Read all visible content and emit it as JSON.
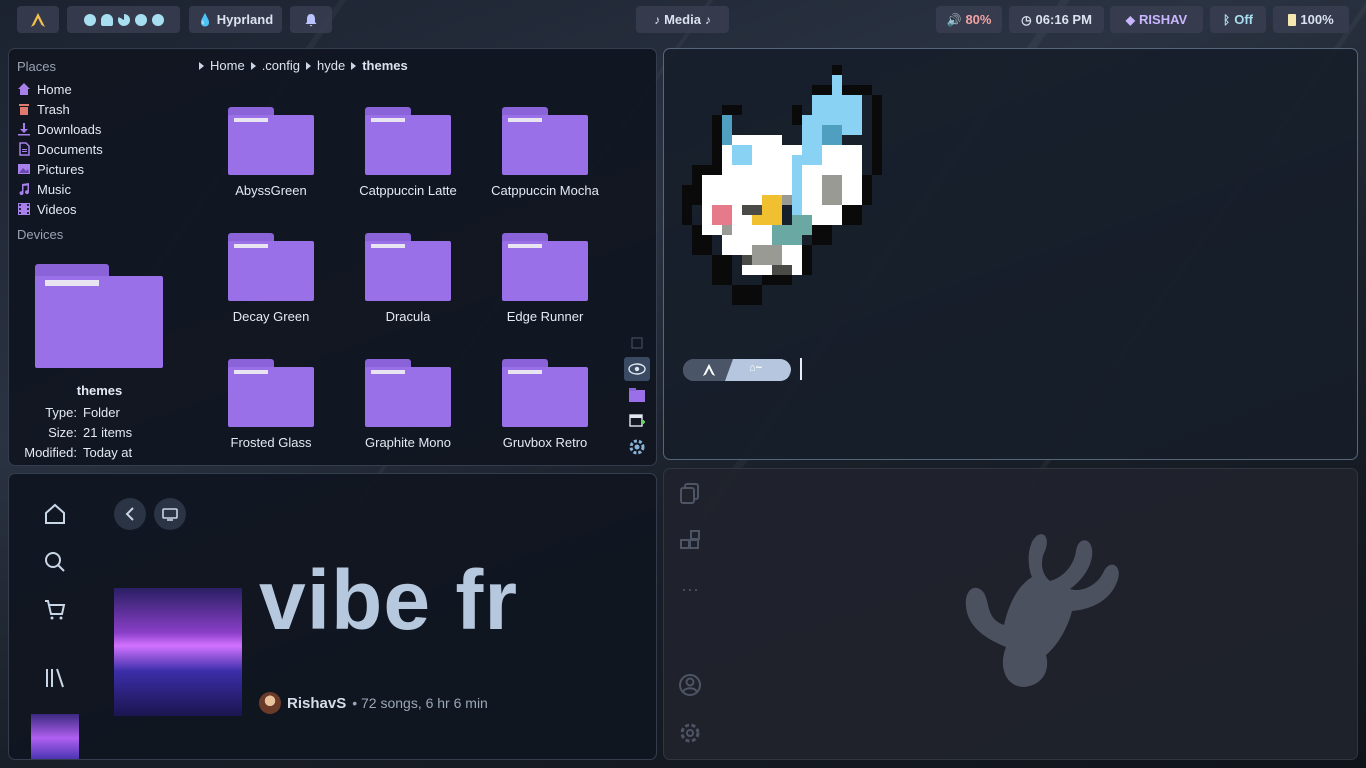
{
  "topbar": {
    "launcher_icon": "arch-logo-icon",
    "workspace_icons": [
      "dot",
      "ghost",
      "pacman",
      "dot",
      "dot"
    ],
    "wm_label": "Hyprland",
    "notification_icon": "bell-icon",
    "media_label": "Media",
    "volume": "80%",
    "clock": "06:16 PM",
    "user": "RISHAV",
    "bluetooth": "Off",
    "battery": "100%"
  },
  "files": {
    "places_heading": "Places",
    "places": [
      {
        "label": "Home",
        "icon": "home-icon"
      },
      {
        "label": "Trash",
        "icon": "trash-icon"
      },
      {
        "label": "Downloads",
        "icon": "download-icon"
      },
      {
        "label": "Documents",
        "icon": "document-icon"
      },
      {
        "label": "Pictures",
        "icon": "picture-icon"
      },
      {
        "label": "Music",
        "icon": "music-icon"
      },
      {
        "label": "Videos",
        "icon": "video-icon"
      }
    ],
    "devices_heading": "Devices",
    "selected": {
      "name": "themes",
      "type_label": "Type:",
      "type_value": "Folder",
      "size_label": "Size:",
      "size_value": "21 items",
      "modified_label": "Modified:",
      "modified_value": "Today at"
    },
    "breadcrumb": [
      "Home",
      ".config",
      "hyde",
      "themes"
    ],
    "folders": [
      "AbyssGreen",
      "Catppuccin Latte",
      "Catppuccin Mocha",
      "Decay Green",
      "Dracula",
      "Edge Runner",
      "Frosted Glass",
      "Graphite Mono",
      "Gruvbox Retro"
    ]
  },
  "terminal": {
    "prompt_os_icon": "arch-logo-icon",
    "prompt_dir": "~"
  },
  "music": {
    "playlist_title": "vibe fr",
    "owner": "RishavS",
    "meta": "• 72 songs, 6 hr 6 min",
    "nav_icons": [
      "home-icon",
      "search-icon",
      "cart-icon",
      "library-icon"
    ]
  },
  "vesktop": {
    "icons": [
      "copy-icon",
      "widgets-icon",
      "more-icon",
      "account-icon",
      "settings-icon"
    ],
    "logo": "vesktop-antler-logo"
  },
  "colors": {
    "folder": "#9a70e8",
    "accent": "#b6c8dd",
    "panel": "#101620"
  }
}
